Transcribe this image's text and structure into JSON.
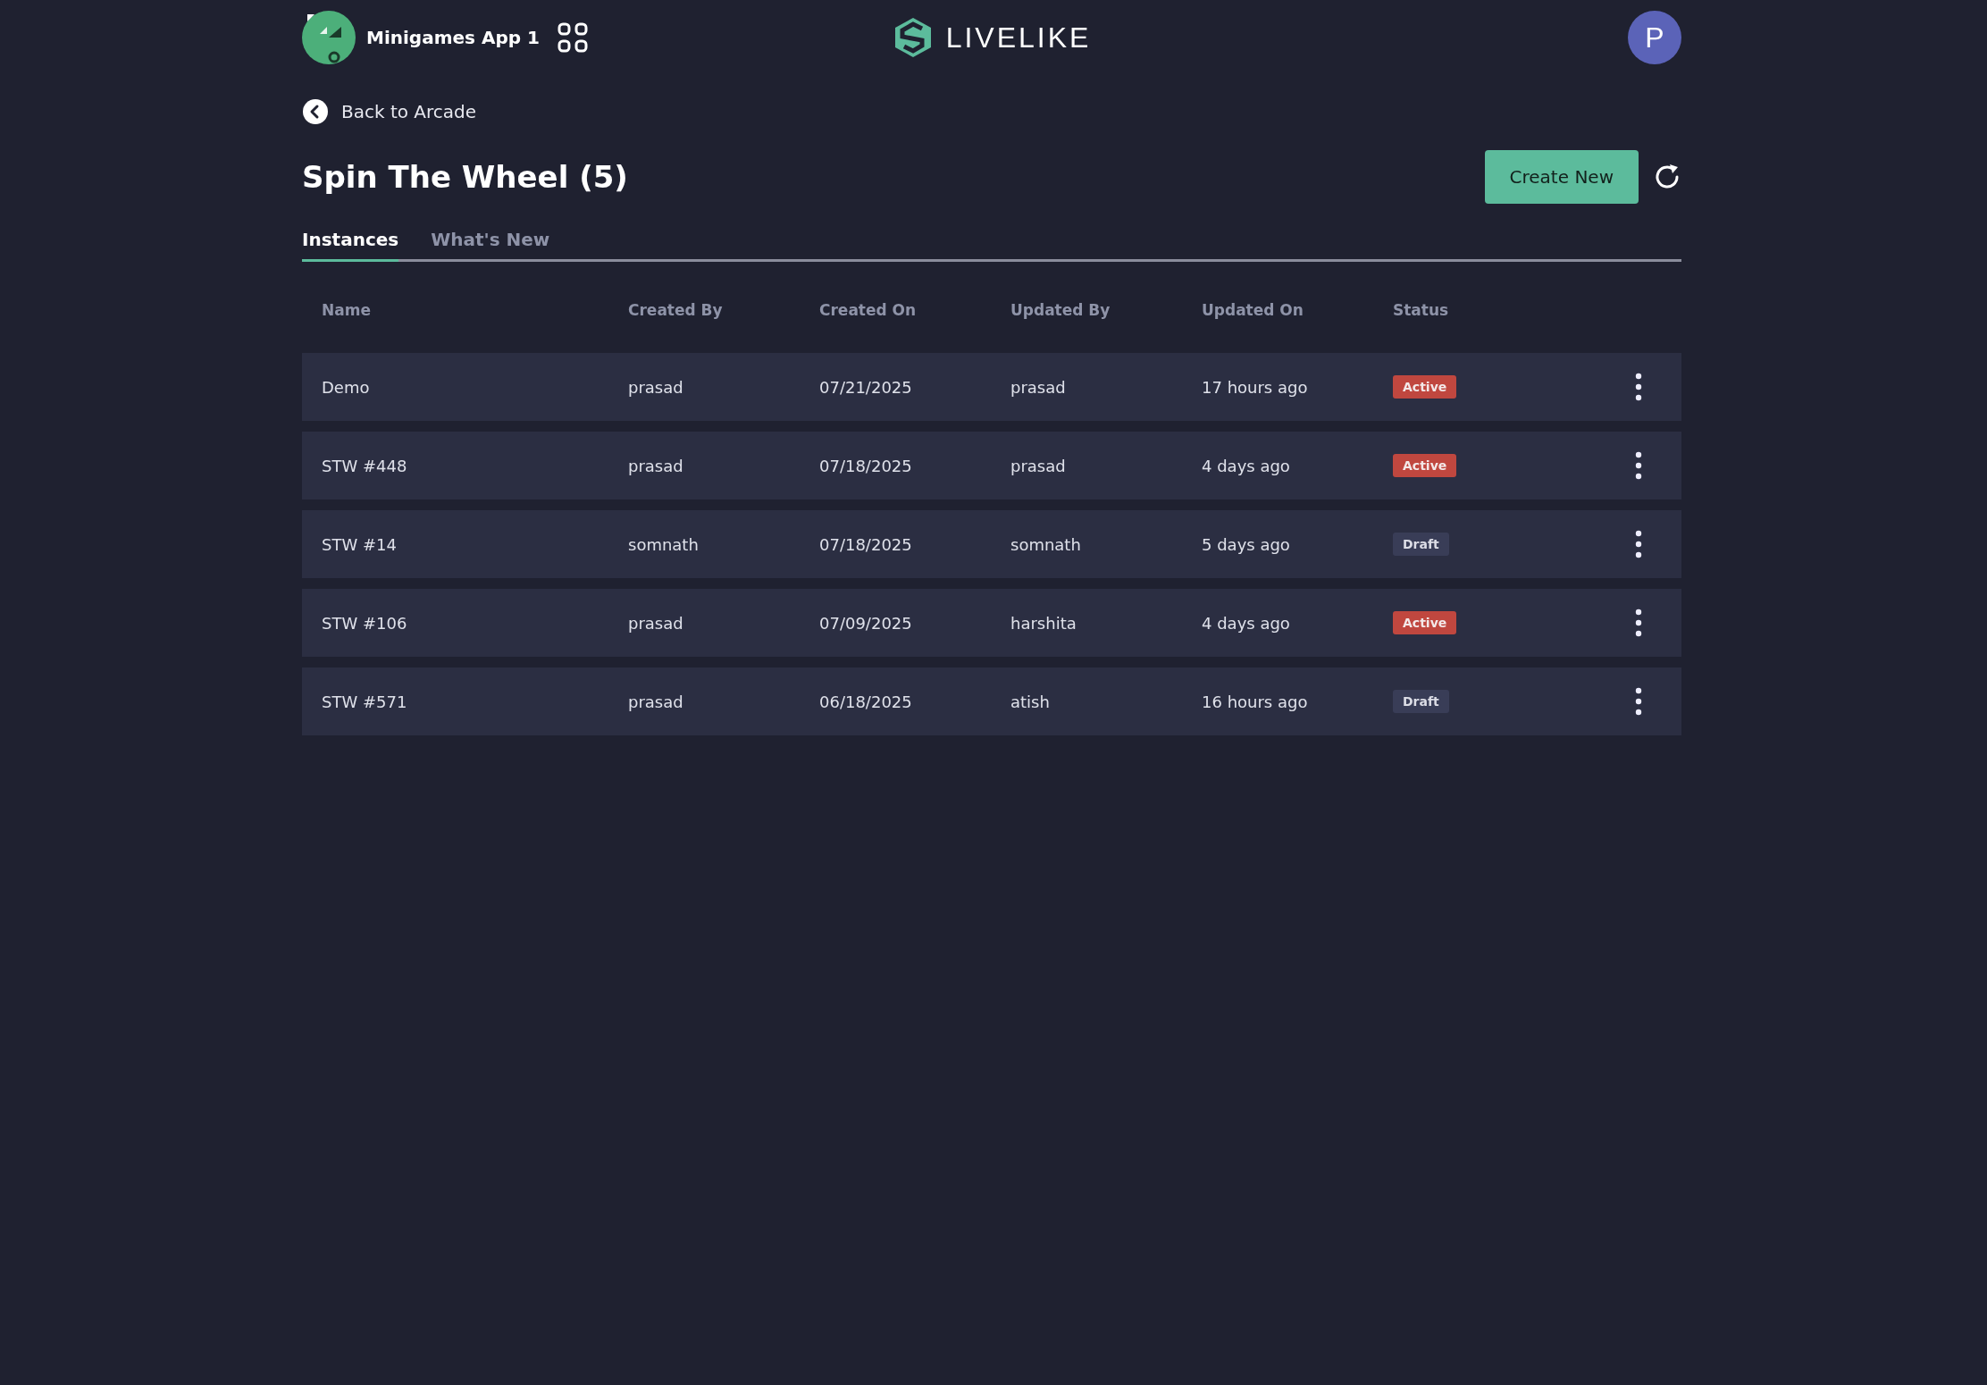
{
  "header": {
    "app_name": "Minigames App 1",
    "brand": "LIVELIKE",
    "avatar_letter": "P"
  },
  "back_link": "Back to Arcade",
  "page_title": "Spin The Wheel (5)",
  "create_button": "Create New",
  "tabs": [
    {
      "label": "Instances",
      "selected": true
    },
    {
      "label": "What's New",
      "selected": false
    }
  ],
  "table": {
    "columns": [
      "Name",
      "Created By",
      "Created On",
      "Updated By",
      "Updated On",
      "Status"
    ],
    "rows": [
      {
        "cells": [
          "Demo",
          "prasad",
          "07/21/2025",
          "prasad",
          "17 hours ago"
        ],
        "status": {
          "label": "Active",
          "kind": "active"
        }
      },
      {
        "cells": [
          "STW #448",
          "prasad",
          "07/18/2025",
          "prasad",
          "4 days ago"
        ],
        "status": {
          "label": "Active",
          "kind": "active"
        }
      },
      {
        "cells": [
          "STW #14",
          "somnath",
          "07/18/2025",
          "somnath",
          "5 days ago"
        ],
        "status": {
          "label": "Draft",
          "kind": "draft"
        }
      },
      {
        "cells": [
          "STW #106",
          "prasad",
          "07/09/2025",
          "harshita",
          "4 days ago"
        ],
        "status": {
          "label": "Active",
          "kind": "active"
        }
      },
      {
        "cells": [
          "STW #571",
          "prasad",
          "06/18/2025",
          "atish",
          "16 hours ago"
        ],
        "status": {
          "label": "Draft",
          "kind": "draft"
        }
      }
    ]
  }
}
